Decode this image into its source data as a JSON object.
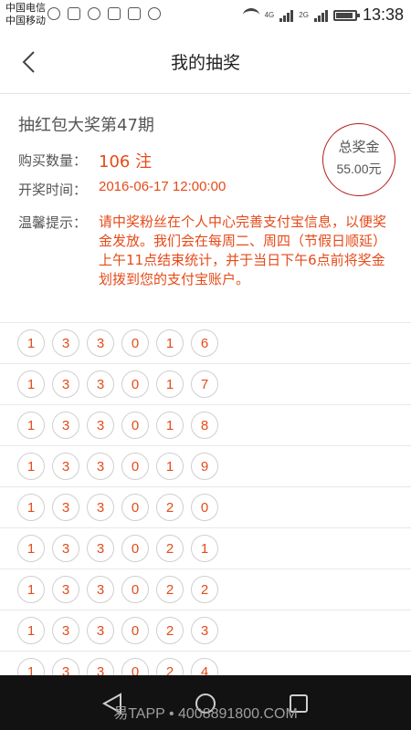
{
  "status_bar": {
    "carrier1": "中国电信",
    "carrier2": "中国移动",
    "net1": "4G",
    "net2": "2G",
    "time": "13:38"
  },
  "header": {
    "title": "我的抽奖",
    "back_icon": "chevron-left-icon"
  },
  "lottery": {
    "title": "抽红包大奖第47期",
    "quantity_label": "购买数量：",
    "quantity_value": "106 注",
    "time_label": "开奖时间：",
    "time_value": "2016-06-17 12:00:00",
    "prize_label": "总奖金",
    "prize_amount": "55.00元",
    "tip_label": "温馨提示：",
    "tip_text": "请中奖粉丝在个人中心完善支付宝信息，以便奖金发放。我们会在每周二、周四（节假日顺延）上午11点结束统计，并于当日下午6点前将奖金划拨到您的支付宝账户。"
  },
  "tickets": [
    [
      "1",
      "3",
      "3",
      "0",
      "1",
      "6"
    ],
    [
      "1",
      "3",
      "3",
      "0",
      "1",
      "7"
    ],
    [
      "1",
      "3",
      "3",
      "0",
      "1",
      "8"
    ],
    [
      "1",
      "3",
      "3",
      "0",
      "1",
      "9"
    ],
    [
      "1",
      "3",
      "3",
      "0",
      "2",
      "0"
    ],
    [
      "1",
      "3",
      "3",
      "0",
      "2",
      "1"
    ],
    [
      "1",
      "3",
      "3",
      "0",
      "2",
      "2"
    ],
    [
      "1",
      "3",
      "3",
      "0",
      "2",
      "3"
    ],
    [
      "1",
      "3",
      "3",
      "0",
      "2",
      "4"
    ]
  ],
  "footer": {
    "watermark": "易TAPP • 4008891800.COM"
  },
  "colors": {
    "accent": "#e64a19",
    "circle_border": "#b71c1c"
  }
}
